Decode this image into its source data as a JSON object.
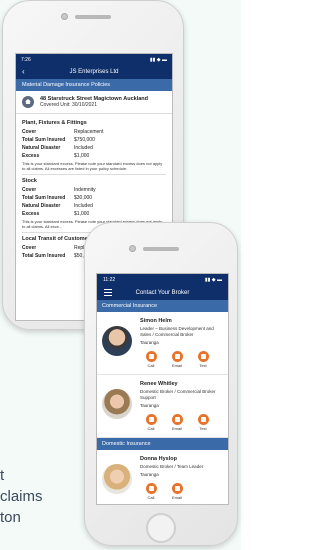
{
  "background": {
    "text_line_1": "t",
    "text_line_2": "claims",
    "text_line_3": "ton"
  },
  "phone1": {
    "status_time": "7:26",
    "status_icons": "▮▮ ◆ ▬",
    "app_title": "JS Enterprises Ltd",
    "subbar": "Material Damage Insurance Policies",
    "address_line1": "48 Starstruck Street Magictown  Auckland",
    "address_line2": "Covered Unit: 30/10/2021",
    "sections": [
      {
        "title": "Plant, Fixtures & Fittings",
        "rows": [
          {
            "k": "Cover",
            "v": "Replacement"
          },
          {
            "k": "Total Sum Insured",
            "v": "$750,000"
          },
          {
            "k": "Natural Disaster",
            "v": "Included"
          },
          {
            "k": "Excess",
            "v": "$1,000"
          }
        ],
        "note": "This is your standard excess. Please note your standard excess does not apply to all claims. All excesses are listed in your policy schedule."
      },
      {
        "title": "Stock",
        "rows": [
          {
            "k": "Cover",
            "v": "Indemnity"
          },
          {
            "k": "Total Sum Insured",
            "v": "$30,000"
          },
          {
            "k": "Natural Disaster",
            "v": "Included"
          },
          {
            "k": "Excess",
            "v": "$1,000"
          }
        ],
        "note": "This is your standard excess. Please note your standard excess does not apply to all claims. All exce..."
      },
      {
        "title": "Local Transit of Customers...",
        "rows": [
          {
            "k": "Cover",
            "v": "Repla..."
          },
          {
            "k": "Total Sum Insured",
            "v": "$50,0..."
          }
        ],
        "note": ""
      }
    ]
  },
  "phone2": {
    "status_time": "11:22",
    "status_icons": "▮▮ ◆ ▬",
    "app_title": "Contact Your Broker",
    "groups": [
      {
        "label": "Commercial Insurance",
        "contacts": [
          {
            "name": "Simon Helm",
            "role": "Leader – Business Development and Sales / Commercial Broker",
            "location": "Tauranga",
            "actions": [
              "Call",
              "Email",
              "Text"
            ]
          },
          {
            "name": "Renee Whitley",
            "role": "Domestic Broker / Commercial Broker Support",
            "location": "Tauranga",
            "actions": [
              "Call",
              "Email",
              "Text"
            ]
          }
        ]
      },
      {
        "label": "Domestic Insurance",
        "contacts": [
          {
            "name": "Donna Hyslop",
            "role": "Domestic Broker / Team Leader",
            "location": "Tauranga",
            "actions": [
              "Call",
              "Email"
            ]
          }
        ]
      }
    ]
  }
}
